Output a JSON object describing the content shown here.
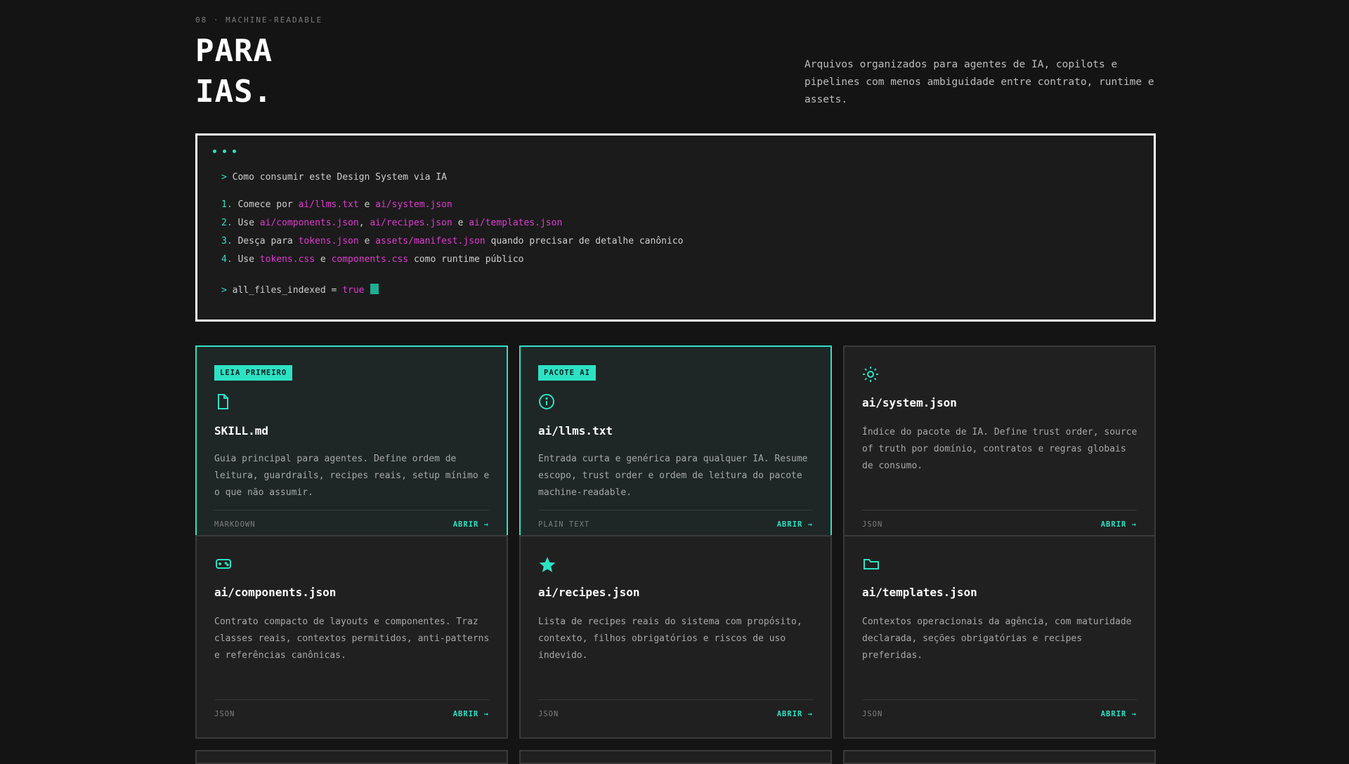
{
  "section": {
    "eyebrow": "08 · MACHINE-READABLE",
    "title_line1": "PARA",
    "title_line2": "IAS.",
    "intro": "Arquivos organizados para agentes de IA, copilots e pipelines com menos ambiguidade entre contrato, runtime e assets."
  },
  "terminal": {
    "prompt": ">",
    "heading": "Como consumir este Design System via IA",
    "steps": [
      {
        "num": "1.",
        "parts": [
          {
            "t": "Comece por "
          },
          {
            "t": "ai/llms.txt",
            "hl": true
          },
          {
            "t": " e "
          },
          {
            "t": "ai/system.json",
            "hl": true
          }
        ]
      },
      {
        "num": "2.",
        "parts": [
          {
            "t": "Use "
          },
          {
            "t": "ai/components.json",
            "hl": true
          },
          {
            "t": ", "
          },
          {
            "t": "ai/recipes.json",
            "hl": true
          },
          {
            "t": " e "
          },
          {
            "t": "ai/templates.json",
            "hl": true
          }
        ]
      },
      {
        "num": "3.",
        "parts": [
          {
            "t": "Desça para "
          },
          {
            "t": "tokens.json",
            "hl": true
          },
          {
            "t": " e "
          },
          {
            "t": "assets/manifest.json",
            "hl": true
          },
          {
            "t": " quando precisar de detalhe canônico"
          }
        ]
      },
      {
        "num": "4.",
        "parts": [
          {
            "t": "Use "
          },
          {
            "t": "tokens.css",
            "hl": true
          },
          {
            "t": " e "
          },
          {
            "t": "components.css",
            "hl": true
          },
          {
            "t": " como runtime público"
          }
        ]
      }
    ],
    "status_key": "all_files_indexed = ",
    "status_value": "true"
  },
  "cards": [
    {
      "badge": "LEIA PRIMEIRO",
      "icon": "document-icon",
      "title": "SKILL.md",
      "desc": "Guia principal para agentes. Define ordem de leitura, guardrails, recipes reais, setup mínimo e o que não assumir.",
      "format": "MARKDOWN",
      "action": "ABRIR →",
      "featured": true
    },
    {
      "badge": "PACOTE AI",
      "icon": "info-icon",
      "title": "ai/llms.txt",
      "desc": "Entrada curta e genérica para qualquer IA. Resume escopo, trust order e ordem de leitura do pacote machine-readable.",
      "format": "PLAIN TEXT",
      "action": "ABRIR →",
      "featured": true
    },
    {
      "badge": "",
      "icon": "sun-icon",
      "title": "ai/system.json",
      "desc": "Índice do pacote de IA. Define trust order, source of truth por domínio, contratos e regras globais de consumo.",
      "format": "JSON",
      "action": "ABRIR →",
      "featured": false
    },
    {
      "badge": "",
      "icon": "gamepad-icon",
      "title": "ai/components.json",
      "desc": "Contrato compacto de layouts e componentes. Traz classes reais, contextos permitidos, anti-patterns e referências canônicas.",
      "format": "JSON",
      "action": "ABRIR →",
      "featured": false
    },
    {
      "badge": "",
      "icon": "star-icon",
      "title": "ai/recipes.json",
      "desc": "Lista de recipes reais do sistema com propósito, contexto, filhos obrigatórios e riscos de uso indevido.",
      "format": "JSON",
      "action": "ABRIR →",
      "featured": false
    },
    {
      "badge": "",
      "icon": "folder-icon",
      "title": "ai/templates.json",
      "desc": "Contextos operacionais da agência, com maturidade declarada, seções obrigatórias e recipes preferidas.",
      "format": "JSON",
      "action": "ABRIR →",
      "featured": false
    }
  ],
  "colors": {
    "accent": "#2de2c4",
    "highlight": "#e13ad2",
    "background": "#141414"
  }
}
